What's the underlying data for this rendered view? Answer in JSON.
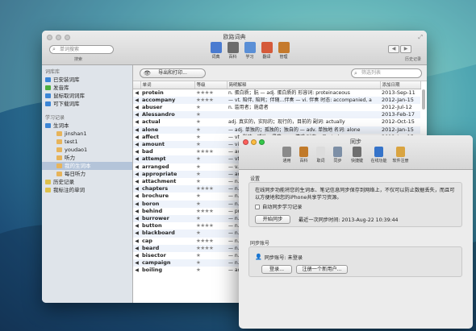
{
  "main_window": {
    "title": "欧路词典",
    "search_placeholder": "单词搜索",
    "search_label": "搜索",
    "history_label": "历史记录",
    "toolbar": [
      {
        "label": "词典",
        "icon": "dictionary-icon",
        "color": "#4a7bd0"
      },
      {
        "label": "百科",
        "icon": "wiki-icon",
        "color": "#6b6b6b"
      },
      {
        "label": "学习",
        "icon": "study-icon",
        "color": "#5a8fd6"
      },
      {
        "label": "翻译",
        "icon": "translate-icon",
        "color": "#d55a3a"
      },
      {
        "label": "管理",
        "icon": "manage-icon",
        "color": "#c57a2c"
      }
    ],
    "export_label": "导出和打印...",
    "filter_placeholder": "筛选列表"
  },
  "sidebar": {
    "section1": "词库库",
    "libraries": [
      {
        "label": "已安装词库",
        "color": "#3b86d6"
      },
      {
        "label": "发音库",
        "color": "#4cae3f"
      },
      {
        "label": "鼠标取词词库",
        "color": "#3b86d6"
      },
      {
        "label": "可下载词库",
        "color": "#3b86d6"
      }
    ],
    "section2": "学习记录",
    "study": [
      {
        "label": "生词本",
        "child": false,
        "color": "#3b86d6"
      },
      {
        "label": "jinshan1",
        "child": true,
        "color": "#e7b45b"
      },
      {
        "label": "test1",
        "child": true,
        "color": "#e7b45b"
      },
      {
        "label": "youdao1",
        "child": true,
        "color": "#e7b45b"
      },
      {
        "label": "听力",
        "child": true,
        "color": "#e7b45b"
      },
      {
        "label": "我的生词本",
        "child": true,
        "color": "#e7b45b",
        "selected": true
      },
      {
        "label": "每日听力",
        "child": true,
        "color": "#e7b45b"
      },
      {
        "label": "历史记录",
        "child": false,
        "color": "#ddc14a"
      },
      {
        "label": "我标注的单词",
        "child": false,
        "color": "#ddc14a"
      }
    ]
  },
  "table": {
    "headers": [
      "单词",
      "等级",
      "简明解释",
      "添加日期"
    ],
    "rows": [
      {
        "word": "protein",
        "level": "★★★★",
        "def": "n. 蛋白质；朊 — adj. 蛋白质的 形容词: proteinaceous",
        "date": "2013-Sep-11"
      },
      {
        "word": "accompany",
        "level": "★★★★",
        "def": "— vt. 陪伴, 陪同；伴随…伴奏 — vi. 伴奏 时态: accompanied, a",
        "date": "2012-Jan-15"
      },
      {
        "word": "abuser",
        "level": "★",
        "def": "n. 滥用者；施虐者",
        "date": "2012-Jul-12"
      },
      {
        "word": "Alessandro",
        "level": "★",
        "def": "",
        "date": "2013-Feb-17"
      },
      {
        "word": "actual",
        "level": "★",
        "def": "adj. 真实的，实际的；现行的，目前的 副词: actually",
        "date": "2012-Oct-15"
      },
      {
        "word": "alone",
        "level": "★",
        "def": "— adj. 单独的；孤独的；独自的 — adv. 单独地 名词: alone",
        "date": "2012-Jan-15"
      },
      {
        "word": "affect",
        "level": "★",
        "def": "— vt. 影响；感动；侵袭 — n. 情感 时态: affected",
        "date": "2012-Jan-15"
      },
      {
        "word": "amount",
        "level": "★",
        "def": "— vi. 总计；相当于 — n. 数量；总额",
        "date": "2012-Jan-15"
      },
      {
        "word": "bad",
        "level": "★★★★",
        "def": "— adj. 坏的；严重的；劣质的",
        "date": "2012-Jan-15"
      },
      {
        "word": "attempt",
        "level": "★",
        "def": "— vt. 企图，试图；尝试",
        "date": "2012-Jan-15"
      },
      {
        "word": "arranged",
        "level": "★",
        "def": "— v. 安排，整理",
        "date": "2012-Jan-15"
      },
      {
        "word": "appropriate",
        "level": "★",
        "def": "— adj. 适当的 — vt. 占用",
        "date": "2012-Jan-15"
      },
      {
        "word": "attachment",
        "level": "★",
        "def": "— n. 附件；依恋；连接",
        "date": "2012-Jan-15"
      },
      {
        "word": "chapters",
        "level": "★★★★",
        "def": "— n. 章节",
        "date": "2012-Jan-15"
      },
      {
        "word": "brochure",
        "level": "★",
        "def": "— n. 手册，小册子",
        "date": "2012-Jan-15"
      },
      {
        "word": "boron",
        "level": "★",
        "def": "— n. 硼",
        "date": "2012-Jan-15"
      },
      {
        "word": "behind",
        "level": "★★★★",
        "def": "— prep. 在…后面",
        "date": "2012-Jan-15"
      },
      {
        "word": "burrower",
        "level": "★",
        "def": "— n. 穴居动物",
        "date": "2012-Jan-15"
      },
      {
        "word": "button",
        "level": "★★★★",
        "def": "— n. 按钮",
        "date": "2012-Jan-15"
      },
      {
        "word": "blackboard",
        "level": "★",
        "def": "— n. 黑板",
        "date": "2012-Jan-15"
      },
      {
        "word": "cap",
        "level": "★★★★",
        "def": "— n. 帽子",
        "date": "2012-Jan-15"
      },
      {
        "word": "beard",
        "level": "★★★★",
        "def": "— n. 胡须",
        "date": "2012-Jan-15"
      },
      {
        "word": "bisector",
        "level": "★",
        "def": "— n. 平分线",
        "date": "2012-Jan-15"
      },
      {
        "word": "campaign",
        "level": "★",
        "def": "— n. 运动",
        "date": "2012-Jan-15"
      },
      {
        "word": "boiling",
        "level": "★",
        "def": "— adj. 沸腾的",
        "date": "2012-Jan-15"
      }
    ]
  },
  "sync_dialog": {
    "title": "同步",
    "tabs": [
      {
        "label": "通用",
        "icon": "general-icon",
        "color": "#8a8a8a"
      },
      {
        "label": "百科",
        "icon": "wiki-icon",
        "color": "#c17a2a"
      },
      {
        "label": "取词",
        "icon": "mouse-icon",
        "color": "#dcdcdc"
      },
      {
        "label": "同步",
        "icon": "sync-icon",
        "color": "#7d8fa6"
      },
      {
        "label": "快捷键",
        "icon": "keyboard-icon",
        "color": "#6e6e6e"
      },
      {
        "label": "在线功能",
        "icon": "globe-icon",
        "color": "#3573c9"
      },
      {
        "label": "软件注册",
        "icon": "lock-icon",
        "color": "#d9a441"
      }
    ],
    "settings_label": "设置",
    "description": "在线同步功能将您的生词本、笔记信息同步保存到网络上，不仅可以防止数据丢失，而且可以方便地和您的iPhone共享学习资源。",
    "auto_sync_label": "自动同步学习记录",
    "start_sync": "开始同步",
    "last_sync": "最近一次同步时间: 2013-Aug-22 10:39:44",
    "account_section": "同步账号",
    "account_status": "同步账号:  未登录",
    "login": "登录...",
    "register": "注册一个新用户..."
  }
}
